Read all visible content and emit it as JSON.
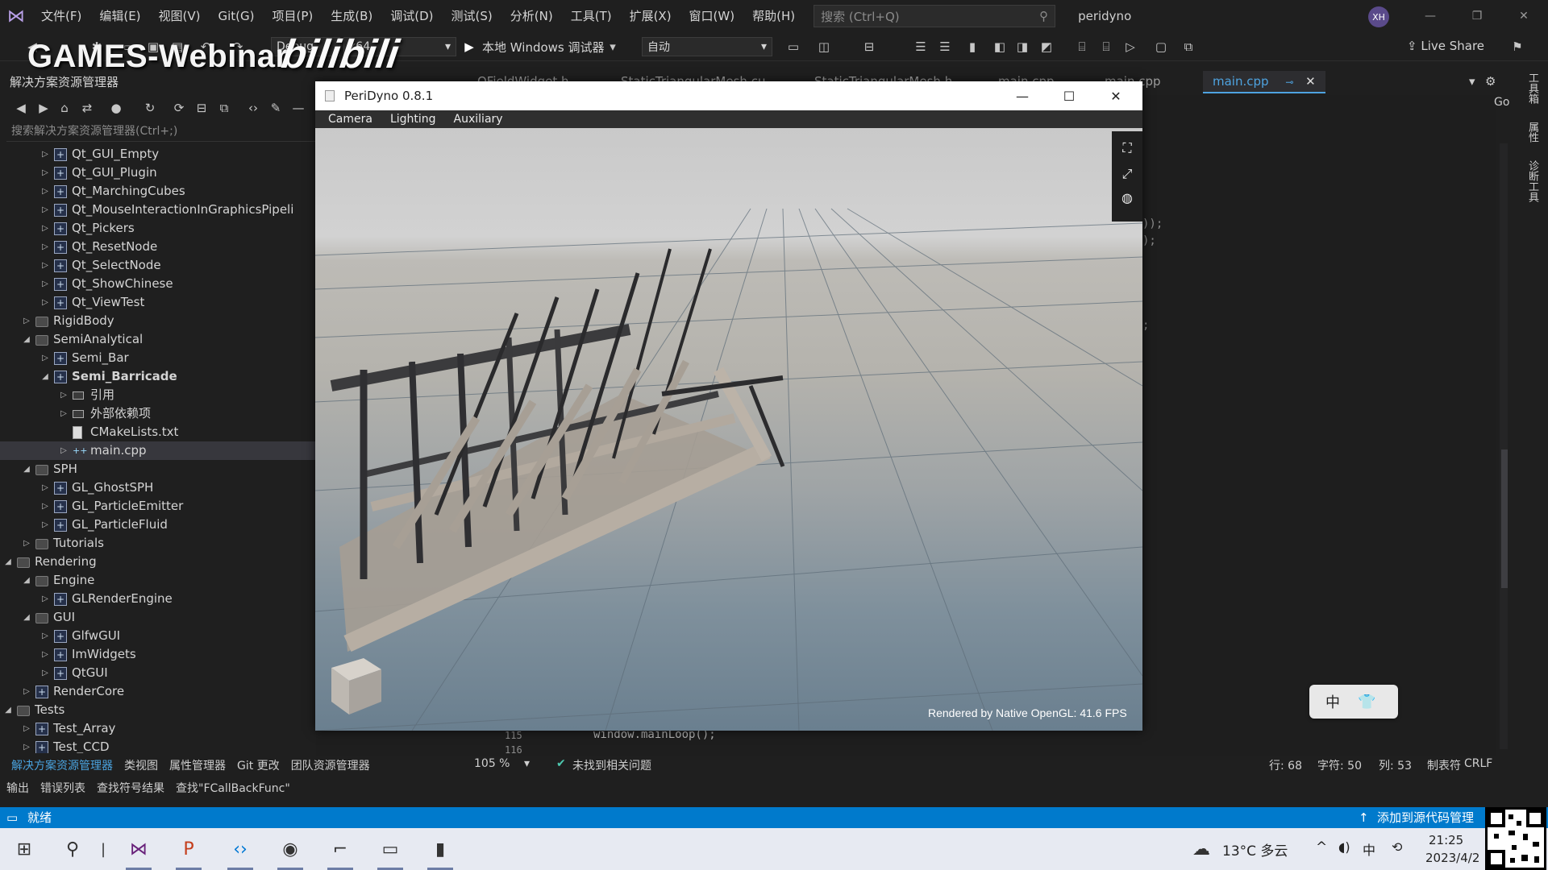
{
  "menubar": {
    "items": [
      "文件(F)",
      "编辑(E)",
      "视图(V)",
      "Git(G)",
      "项目(P)",
      "生成(B)",
      "调试(D)",
      "测试(S)",
      "分析(N)",
      "工具(T)",
      "扩展(X)",
      "窗口(W)",
      "帮助(H)"
    ],
    "search_placeholder": "搜索 (Ctrl+Q)",
    "solution_name": "peridyno",
    "avatar": "XH"
  },
  "toolbar": {
    "config": "Debug",
    "platform": "x64",
    "run_label": "本地 Windows 调试器",
    "auto": "自动",
    "live_share": "Live Share"
  },
  "watermark": {
    "games": "GAMES-Webinar",
    "bili": "bilibili"
  },
  "solution_explorer": {
    "title": "解决方案资源管理器",
    "search_placeholder": "搜索解决方案资源管理器(Ctrl+;)",
    "tree": [
      {
        "label": "Qt_GUI_Empty",
        "indent": 3,
        "arrow": "▷",
        "icon": "proj"
      },
      {
        "label": "Qt_GUI_Plugin",
        "indent": 3,
        "arrow": "▷",
        "icon": "proj"
      },
      {
        "label": "Qt_MarchingCubes",
        "indent": 3,
        "arrow": "▷",
        "icon": "proj"
      },
      {
        "label": "Qt_MouseInteractionInGraphicsPipeli",
        "indent": 3,
        "arrow": "▷",
        "icon": "proj"
      },
      {
        "label": "Qt_Pickers",
        "indent": 3,
        "arrow": "▷",
        "icon": "proj"
      },
      {
        "label": "Qt_ResetNode",
        "indent": 3,
        "arrow": "▷",
        "icon": "proj"
      },
      {
        "label": "Qt_SelectNode",
        "indent": 3,
        "arrow": "▷",
        "icon": "proj"
      },
      {
        "label": "Qt_ShowChinese",
        "indent": 3,
        "arrow": "▷",
        "icon": "proj"
      },
      {
        "label": "Qt_ViewTest",
        "indent": 3,
        "arrow": "▷",
        "icon": "proj"
      },
      {
        "label": "RigidBody",
        "indent": 2,
        "arrow": "▷",
        "icon": "folder"
      },
      {
        "label": "SemiAnalytical",
        "indent": 2,
        "arrow": "◢",
        "icon": "folder"
      },
      {
        "label": "Semi_Bar",
        "indent": 3,
        "arrow": "▷",
        "icon": "proj"
      },
      {
        "label": "Semi_Barricade",
        "indent": 3,
        "arrow": "◢",
        "icon": "proj",
        "bold": true
      },
      {
        "label": "引用",
        "indent": 4,
        "arrow": "▷",
        "icon": "ref"
      },
      {
        "label": "外部依赖项",
        "indent": 4,
        "arrow": "▷",
        "icon": "ref"
      },
      {
        "label": "CMakeLists.txt",
        "indent": 4,
        "arrow": "",
        "icon": "file"
      },
      {
        "label": "main.cpp",
        "indent": 4,
        "arrow": "▷",
        "icon": "cpp",
        "selected": true
      },
      {
        "label": "SPH",
        "indent": 2,
        "arrow": "◢",
        "icon": "folder"
      },
      {
        "label": "GL_GhostSPH",
        "indent": 3,
        "arrow": "▷",
        "icon": "proj"
      },
      {
        "label": "GL_ParticleEmitter",
        "indent": 3,
        "arrow": "▷",
        "icon": "proj"
      },
      {
        "label": "GL_ParticleFluid",
        "indent": 3,
        "arrow": "▷",
        "icon": "proj"
      },
      {
        "label": "Tutorials",
        "indent": 2,
        "arrow": "▷",
        "icon": "folder"
      },
      {
        "label": "Rendering",
        "indent": 1,
        "arrow": "◢",
        "icon": "folder"
      },
      {
        "label": "Engine",
        "indent": 2,
        "arrow": "◢",
        "icon": "folder"
      },
      {
        "label": "GLRenderEngine",
        "indent": 3,
        "arrow": "▷",
        "icon": "proj"
      },
      {
        "label": "GUI",
        "indent": 2,
        "arrow": "◢",
        "icon": "folder"
      },
      {
        "label": "GlfwGUI",
        "indent": 3,
        "arrow": "▷",
        "icon": "proj"
      },
      {
        "label": "ImWidgets",
        "indent": 3,
        "arrow": "▷",
        "icon": "proj"
      },
      {
        "label": "QtGUI",
        "indent": 3,
        "arrow": "▷",
        "icon": "proj"
      },
      {
        "label": "RenderCore",
        "indent": 2,
        "arrow": "▷",
        "icon": "proj"
      },
      {
        "label": "Tests",
        "indent": 1,
        "arrow": "◢",
        "icon": "folder"
      },
      {
        "label": "Test_Array",
        "indent": 2,
        "arrow": "▷",
        "icon": "proj"
      },
      {
        "label": "Test_CCD",
        "indent": 2,
        "arrow": "▷",
        "icon": "proj"
      }
    ],
    "bottom_tabs": [
      "解决方案资源管理器",
      "类视图",
      "属性管理器",
      "Git 更改",
      "团队资源管理器"
    ]
  },
  "output_tabs": [
    "输出",
    "错误列表",
    "查找符号结果",
    "查找\"FCallBackFunc\""
  ],
  "editor": {
    "tabs": [
      "QFieldWidget.h",
      "StaticTriangularMesh.cu",
      "StaticTriangularMesh.h",
      "main.cpp",
      "main.cpp",
      "main.cpp"
    ],
    "go_label": "Go",
    "code_fragments": [
      "));",
      ");",
      ";"
    ],
    "line_numbers": [
      "115",
      "116"
    ],
    "code_line": "window.mainLoop();",
    "zoom": "105 %",
    "issues": "未找到相关问题",
    "position": {
      "line": "行: 68",
      "char": "字符: 50",
      "col": "列: 53",
      "tab": "制表符",
      "eol": "CRLF"
    }
  },
  "side_panel_labels": [
    "工具箱",
    "属性",
    "诊断工具"
  ],
  "statusbar": {
    "ready": "就绪",
    "source_control": "添加到源代码管理"
  },
  "peridyno": {
    "title": "PeriDyno 0.8.1",
    "menu": [
      "Camera",
      "Lighting",
      "Auxiliary"
    ],
    "fps_text": "Rendered by Native OpenGL: 41.6 FPS"
  },
  "ime": {
    "lang": "中"
  },
  "taskbar": {
    "weather": "13°C 多云",
    "time": "21:25",
    "date": "2023/4/2"
  },
  "colors": {
    "accent": "#007acc",
    "active_tab": "#4ea3e0",
    "taskbar": "#e7eaf2"
  }
}
